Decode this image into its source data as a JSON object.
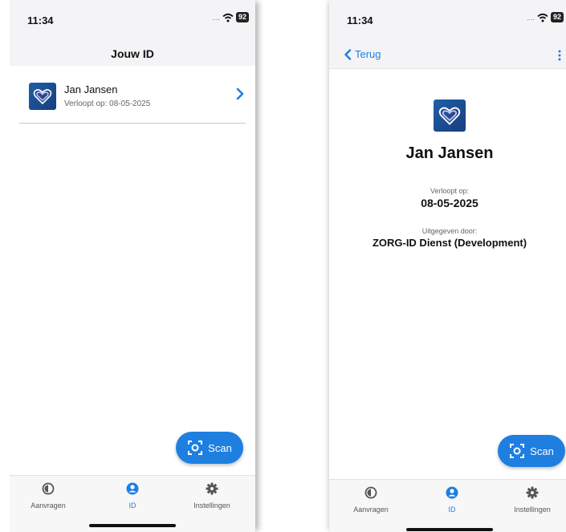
{
  "colors": {
    "accent": "#1f7fe0",
    "icon_bg": "#1f5ea8",
    "divider": "#c9c9c9"
  },
  "status_bar": {
    "time": "11:34",
    "battery": "92"
  },
  "left_screen": {
    "title": "Jouw ID",
    "list": [
      {
        "name": "Jan Jansen",
        "expiry_text": "Verloopt op: 08-05-2025",
        "icon": "heart-id-icon"
      }
    ],
    "fab": {
      "label": "Scan",
      "icon": "scan-icon"
    }
  },
  "right_screen": {
    "back_label": "Terug",
    "name": "Jan Jansen",
    "expiry_label": "Verloopt op:",
    "expiry_value": "08-05-2025",
    "issuer_label": "Uitgegeven door:",
    "issuer_value": "ZORG-ID Dienst (Development)",
    "fab": {
      "label": "Scan",
      "icon": "scan-icon"
    }
  },
  "bottom_nav": {
    "items": [
      {
        "label": "Aanvragen",
        "icon": "aanvragen-icon",
        "active": false
      },
      {
        "label": "ID",
        "icon": "user-icon",
        "active": true
      },
      {
        "label": "Instellingen",
        "icon": "gear-icon",
        "active": false
      }
    ]
  }
}
